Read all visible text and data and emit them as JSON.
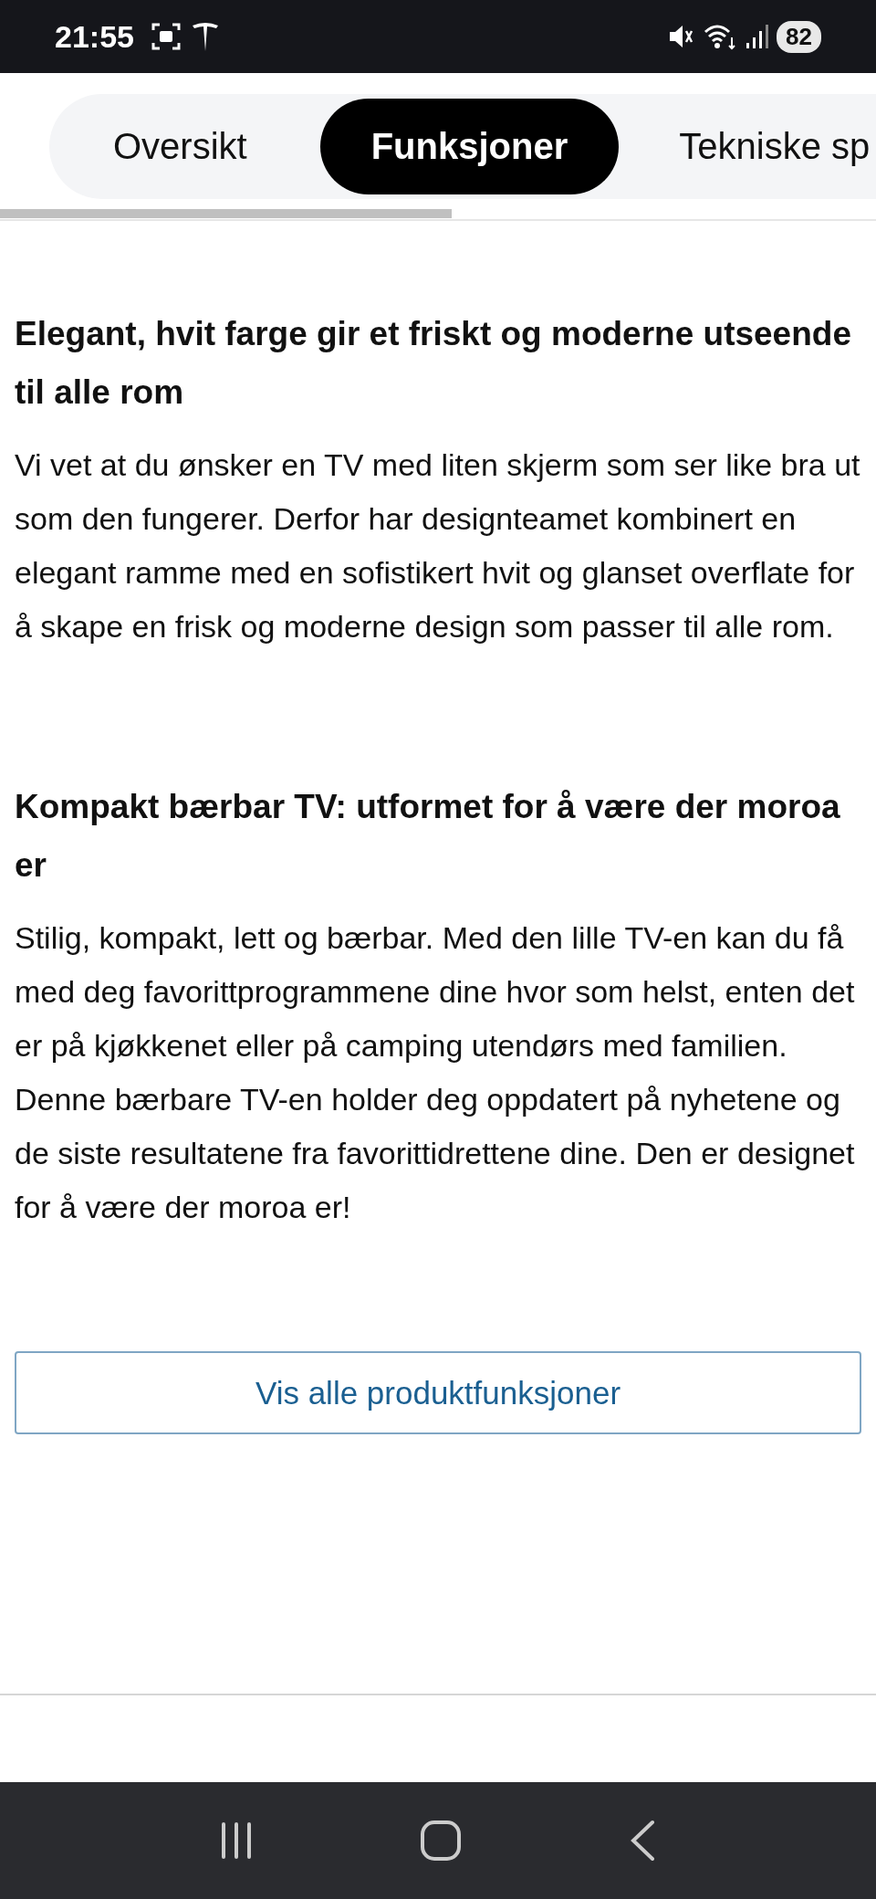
{
  "status_bar": {
    "time": "21:55",
    "battery": "82"
  },
  "tabs": [
    {
      "label": "Oversikt",
      "selected": false
    },
    {
      "label": "Funksjoner",
      "selected": true
    },
    {
      "label": "Tekniske sp",
      "selected": false
    }
  ],
  "sections": [
    {
      "heading": "Elegant, hvit farge gir et friskt og moderne utseende til alle rom",
      "body": "Vi vet at du ønsker en TV med liten skjerm som ser like bra ut som den fungerer. Derfor har designteamet kombinert en elegant ramme med en sofistikert hvit og glanset overflate for å skape en frisk og moderne design som passer til alle rom."
    },
    {
      "heading": "Kompakt bærbar TV: utformet for å være der moroa er",
      "body": "Stilig, kompakt, lett og bærbar. Med den lille TV-en kan du få med deg favorittprogrammene dine hvor som helst, enten det er på kjøkkenet eller på camping utendørs med familien. Denne bærbare TV-en holder deg oppdatert på nyhetene og de siste resultatene fra favorittidrettene dine. Den er designet for å være der moroa er!"
    }
  ],
  "more_button": "Vis alle produktfunksjoner"
}
